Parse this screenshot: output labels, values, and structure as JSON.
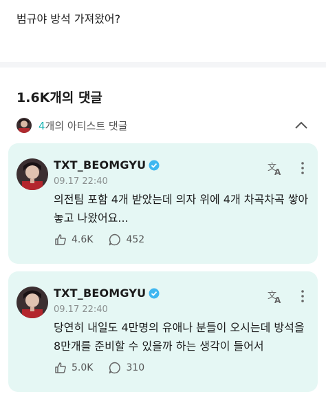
{
  "post": {
    "text": "범규야 방석 가져왔어?"
  },
  "comments_header": {
    "count_label": "1.6K개의 댓글"
  },
  "artist_filter": {
    "count": "4",
    "label_suffix": "개의 아티스트 댓글"
  },
  "comments": [
    {
      "author": "TXT_BEOMGYU",
      "date": "09.17 22:40",
      "text": "의전팀 포함 4개 받았는데 의자 위에 4개 차곡차곡 쌓아놓고 나왔어요...",
      "likes": "4.6K",
      "replies": "452"
    },
    {
      "author": "TXT_BEOMGYU",
      "date": "09.17 22:40",
      "text": "당연히 내일도 4만명의 유애나 분들이 오시는데 방석을 8만개를 준비할 수 있을까 하는 생각이 들어서",
      "likes": "5.0K",
      "replies": "310"
    }
  ],
  "colors": {
    "accent": "#17b3b3",
    "card_bg": "#e5f7f4",
    "verified": "#3fb7f0"
  },
  "icons": [
    "chevron-up-icon",
    "verified-badge-icon",
    "translate-icon",
    "more-options-icon",
    "like-icon",
    "reply-icon"
  ]
}
